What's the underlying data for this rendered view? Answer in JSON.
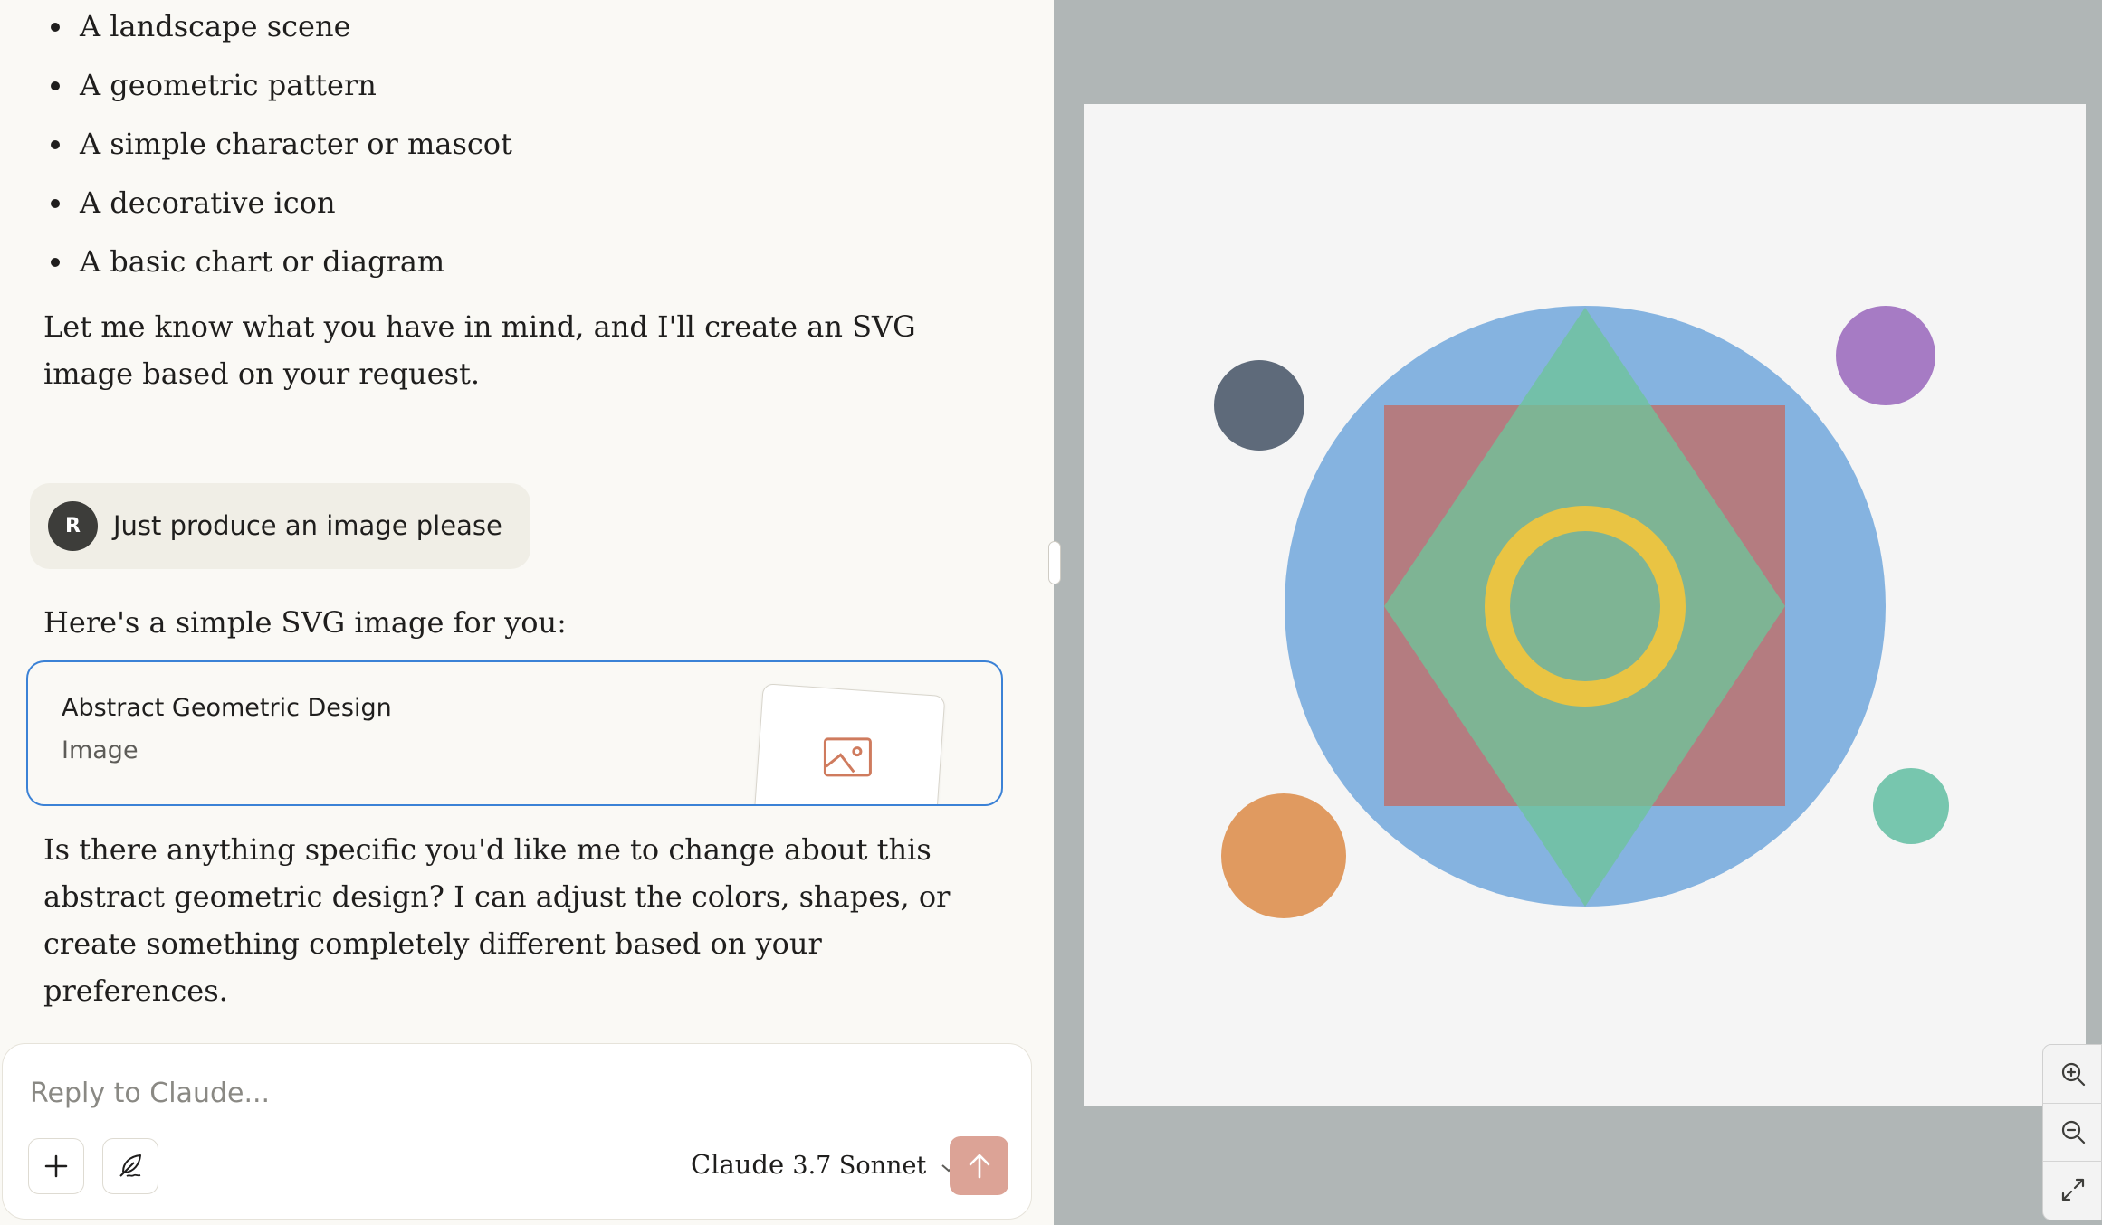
{
  "chat": {
    "bullets": [
      "A landscape scene",
      "A geometric pattern",
      "A simple character or mascot",
      "A decorative icon",
      "A basic chart or diagram"
    ],
    "paragraph1": "Let me know what you have in mind, and I'll create an SVG image based on your request.",
    "user_message": {
      "avatar_initial": "R",
      "text": "Just produce an image please"
    },
    "paragraph2": "Here's a simple SVG image for you:",
    "artifact": {
      "title": "Abstract Geometric Design",
      "kind": "Image",
      "icon": "image-icon"
    },
    "paragraph3": "Is there anything specific you'd like me to change about this abstract geometric design? I can adjust the colors, shapes, or create something completely different based on your preferences."
  },
  "composer": {
    "placeholder": "Reply to Claude...",
    "model_name": "Claude",
    "model_version": "3.7 Sonnet",
    "icons": [
      "plus-icon",
      "feather-icon",
      "arrow-up-icon",
      "chevron-down-icon"
    ]
  },
  "preview": {
    "colors": {
      "background": "#f5f5f5",
      "big_circle": "#85b3e0",
      "square": "#b47c80",
      "diamond": "#6ec49a",
      "ring": "#e9c443",
      "dark_dot": "#5e6a7a",
      "purple_dot": "#a67bc4",
      "teal_dot": "#77c6ae",
      "orange_dot": "#e09a60"
    },
    "zoom_icons": [
      "zoom-in-icon",
      "zoom-out-icon",
      "expand-icon"
    ]
  }
}
